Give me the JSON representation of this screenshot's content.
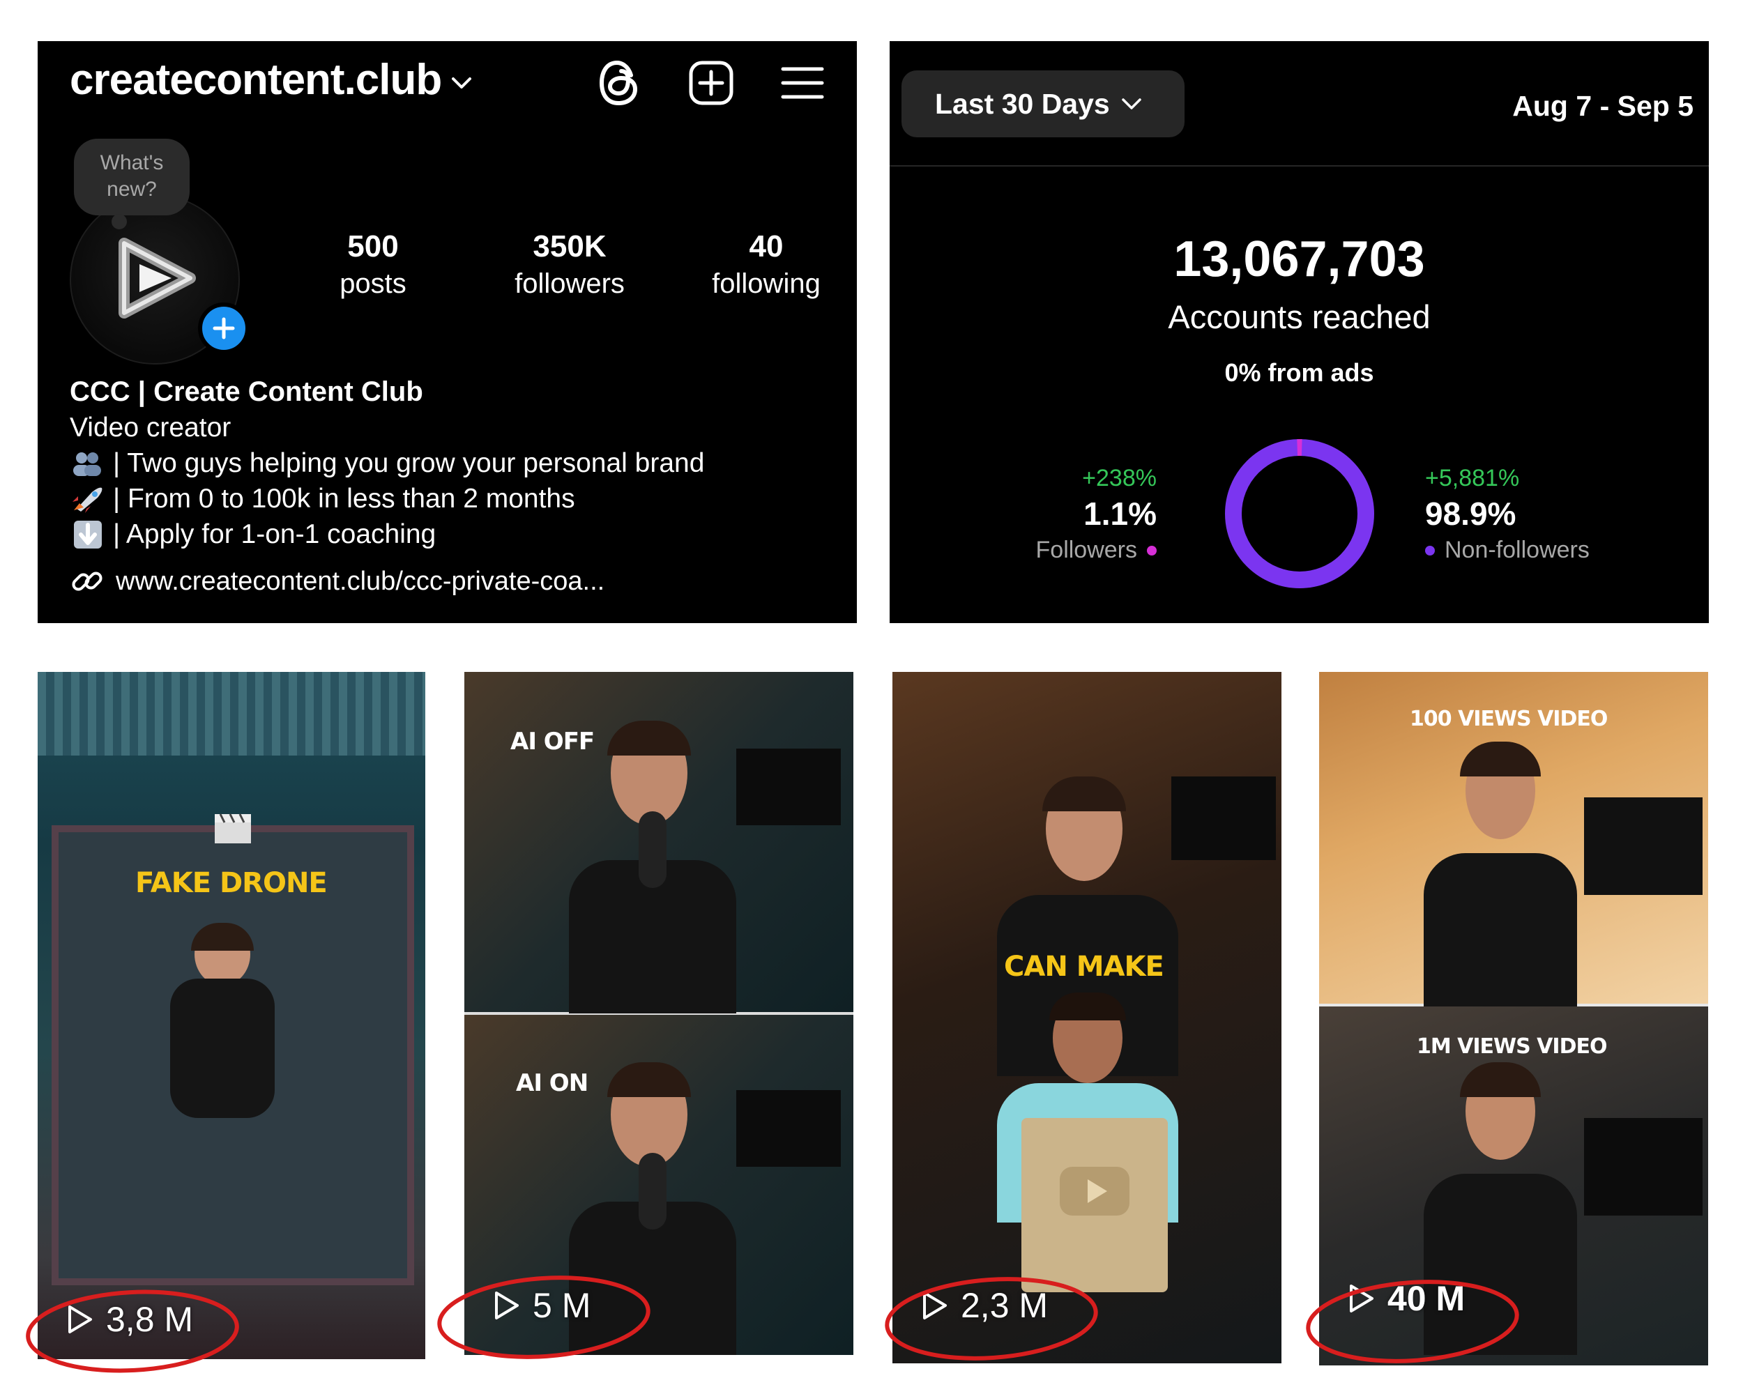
{
  "profile": {
    "username": "createcontent.club",
    "bubble_text": "What's new?",
    "stats": [
      {
        "num": "500",
        "label": "posts"
      },
      {
        "num": "350K",
        "label": "followers"
      },
      {
        "num": "40",
        "label": "following"
      }
    ],
    "name": "CCC | Create Content Club",
    "category": "Video creator",
    "bio_lines": [
      {
        "icon": "people-emoji-icon",
        "text": "| Two guys helping you grow your personal brand"
      },
      {
        "icon": "rocket-emoji-icon",
        "text": "| From 0 to 100k in less than 2 months"
      },
      {
        "icon": "down-arrow-emoji-icon",
        "text": "| Apply for 1-on-1 coaching"
      }
    ],
    "link": "www.createcontent.club/ccc-private-coa..."
  },
  "insights": {
    "range_label": "Last 30 Days",
    "date_range": "Aug 7 - Sep 5",
    "reach_value": "13,067,703",
    "reach_label": "Accounts reached",
    "ads_label": "0% from ads",
    "followers": {
      "delta": "+238%",
      "pct": "1.1%",
      "label": "Followers",
      "share": 0.011,
      "color": "#d62fd6"
    },
    "non_followers": {
      "delta": "+5,881%",
      "pct": "98.9%",
      "label": "Non-followers",
      "share": 0.989,
      "color": "#7b35f0"
    }
  },
  "thumbnails": [
    {
      "caption": "FAKE DRONE",
      "views": "3,8 M"
    },
    {
      "caption_top": "AI OFF",
      "caption_bottom": "AI ON",
      "views": "5 M"
    },
    {
      "caption": "CAN MAKE",
      "views": "2,3 M"
    },
    {
      "caption_top": "100 VIEWS VIDEO",
      "caption_bottom": "1M VIEWS VIDEO",
      "views": "40 M"
    }
  ],
  "colors": {
    "highlight_ring": "#d81e1e",
    "caption_yellow": "#f5c518",
    "accent_blue": "#1a90f0"
  }
}
